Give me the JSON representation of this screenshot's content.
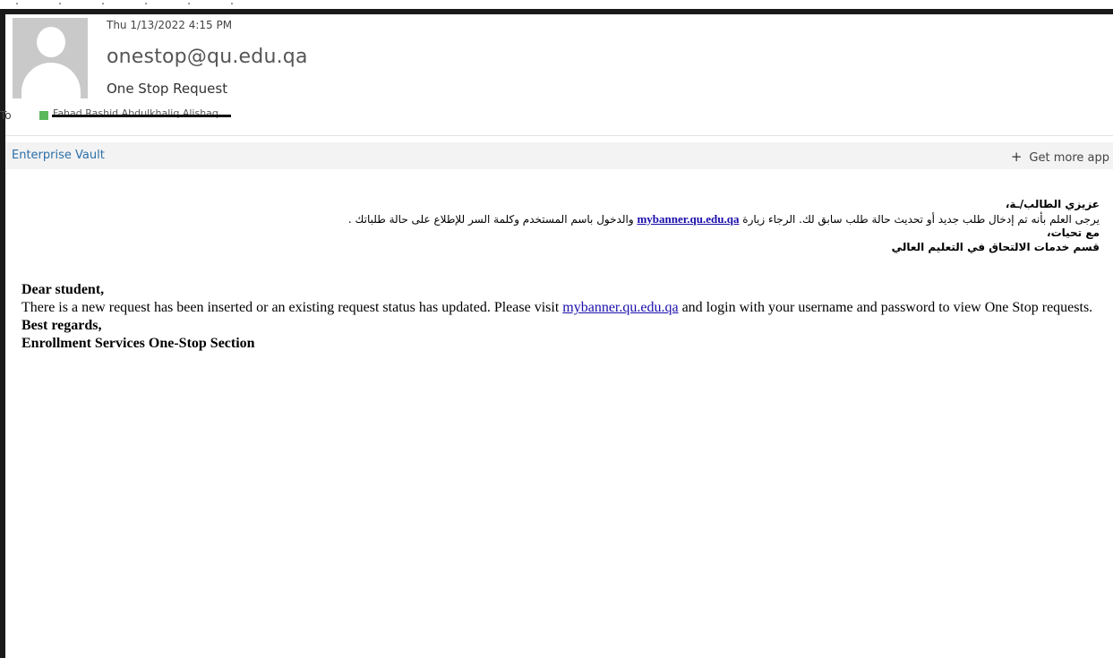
{
  "message": {
    "timestamp": "Thu 1/13/2022 4:15 PM",
    "sender": "onestop@qu.edu.qa",
    "subject": "One Stop Request",
    "to_label": "To",
    "recipient": "Fahad Rashid Abdulkhaliq Alishaq",
    "presence_color": "#5cb85c"
  },
  "addin_bar": {
    "vault_label": "Enterprise Vault",
    "get_more_icon": "plus-icon",
    "get_more_label": "Get more app"
  },
  "body": {
    "arabic": {
      "greeting": "عزيزي الطالب/ـة،",
      "line_prefix": "يرجى العلم بأنه تم إدخال طلب جديد أو تحديث حالة طلب سابق لك. الرجاء زيارة ",
      "link": "mybanner.qu.edu.qa",
      "line_suffix": " والدخول باسم المستخدم وكلمة السر للإطلاع على حالة طلباتك .",
      "closing": "مع تحيات،",
      "department": "قسم خدمات الالتحاق في التعليم العالي"
    },
    "english": {
      "greeting": "Dear student,",
      "line_prefix": "There is a new request has been inserted or an existing request status has updated. Please visit ",
      "link": "mybanner.qu.edu.qa",
      "line_suffix": " and login with your username and password to view One Stop requests.",
      "closing": "Best regards,",
      "department": "Enrollment Services One-Stop Section"
    }
  },
  "colors": {
    "link": "#1a0dab",
    "vault_link": "#2b6ea8",
    "addin_bar_bg": "#f3f3f3"
  }
}
